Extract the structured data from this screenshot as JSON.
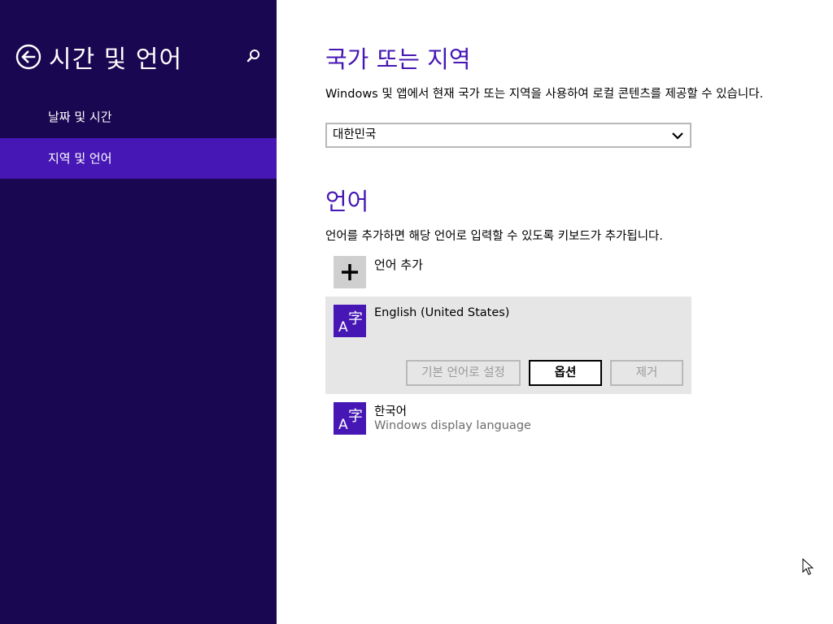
{
  "left_pane": {
    "title": "시간 및 언어",
    "back_icon": "back-arrow-circle-icon",
    "search_icon": "search-icon",
    "nav": [
      {
        "label": "날짜 및 시간",
        "selected": false
      },
      {
        "label": "지역 및 언어",
        "selected": true
      }
    ],
    "bg_color": "#1a0751",
    "selected_color": "#4617b4"
  },
  "region": {
    "heading": "국가 또는 지역",
    "description": "Windows 및 앱에서 현재 국가 또는 지역을 사용하여 로컬 콘텐츠를 제공할 수 있습니다.",
    "selected_value": "대한민국"
  },
  "languages": {
    "heading": "언어",
    "description": "언어를 추가하면 해당 언어로 입력할 수 있도록 키보드가 추가됩니다.",
    "add_label": "언어 추가",
    "list": [
      {
        "name": "English (United States)",
        "sub": "",
        "selected": true,
        "icon_letter_a": "A",
        "icon_letter_z": "字",
        "buttons": {
          "set_default": "기본 언어로 설정",
          "options": "옵션",
          "remove": "제거"
        }
      },
      {
        "name": "한국어",
        "sub": "Windows display language",
        "selected": false,
        "icon_letter_a": "A",
        "icon_letter_z": "字"
      }
    ]
  },
  "accent_color": "#4617b4"
}
